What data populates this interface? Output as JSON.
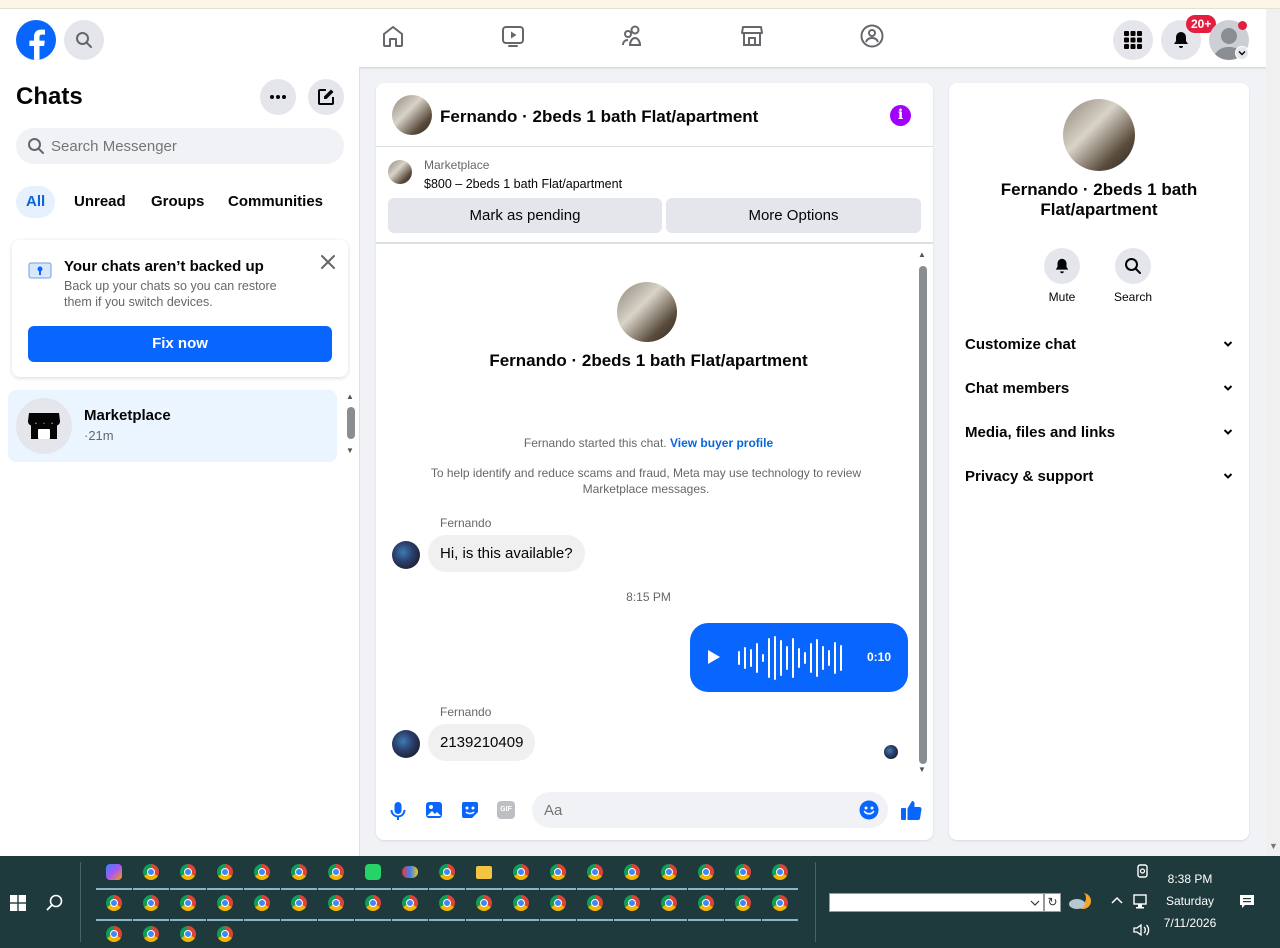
{
  "topnav": {
    "notif_badge": "20+",
    "brand_color": "#0866ff"
  },
  "sidebar": {
    "title": "Chats",
    "search_placeholder": "Search Messenger",
    "tabs": [
      {
        "label": "All",
        "active": true
      },
      {
        "label": "Unread"
      },
      {
        "label": "Groups"
      },
      {
        "label": "Communities"
      }
    ],
    "backup": {
      "title": "Your chats aren’t backed up",
      "desc": "Back up your chats so you can restore them if you switch devices.",
      "button": "Fix now"
    },
    "chat_item": {
      "name": "Marketplace",
      "time": "·21m"
    }
  },
  "chat": {
    "header_title": "Fernando · 2beds 1 bath Flat/apartment",
    "listing": {
      "source": "Marketplace",
      "price_title": "$800 – 2beds 1 bath Flat/apartment",
      "btn_pending": "Mark as pending",
      "btn_options": "More Options"
    },
    "intro_title": "Fernando · 2beds 1 bath Flat/apartment",
    "started_text": "Fernando started this chat.",
    "view_profile": "View buyer profile",
    "scam_notice": "To help identify and reduce scams and fraud, Meta may use technology to review Marketplace messages.",
    "messages": [
      {
        "sender": "Fernando",
        "text": "Hi, is this available?"
      },
      {
        "time": "8:15 PM"
      },
      {
        "voice_duration": "0:10"
      },
      {
        "sender": "Fernando",
        "text": "2139210409"
      }
    ],
    "composer_placeholder": "Aa"
  },
  "info": {
    "title": "Fernando · 2beds 1 bath Flat/apartment",
    "mute": "Mute",
    "search": "Search",
    "sections": [
      "Customize chat",
      "Chat members",
      "Media, files and links",
      "Privacy & support"
    ]
  },
  "taskbar": {
    "time": "8:38 PM",
    "day": "Saturday",
    "date": "7/11/2026"
  }
}
